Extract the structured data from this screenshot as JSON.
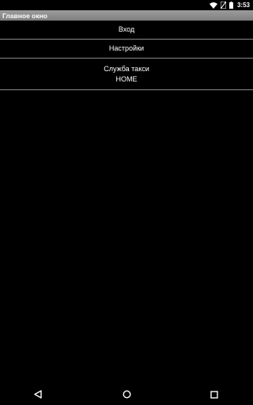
{
  "status_bar": {
    "time": "3:53",
    "icons": [
      "wifi-icon",
      "no-sim-icon",
      "battery-icon"
    ]
  },
  "title_bar": {
    "title": "Главное окно"
  },
  "menu": {
    "items": [
      {
        "lines": [
          "Вход"
        ]
      },
      {
        "lines": [
          "Настройки"
        ]
      },
      {
        "lines": [
          "Служба такси",
          "HOME"
        ]
      }
    ]
  },
  "nav_bar": {
    "icons": [
      "back-icon",
      "home-icon",
      "recent-apps-icon"
    ]
  },
  "colors": {
    "background": "#000000",
    "title_bar": "#8c8c8c",
    "divider": "#8a8a8a",
    "text": "#ffffff"
  }
}
